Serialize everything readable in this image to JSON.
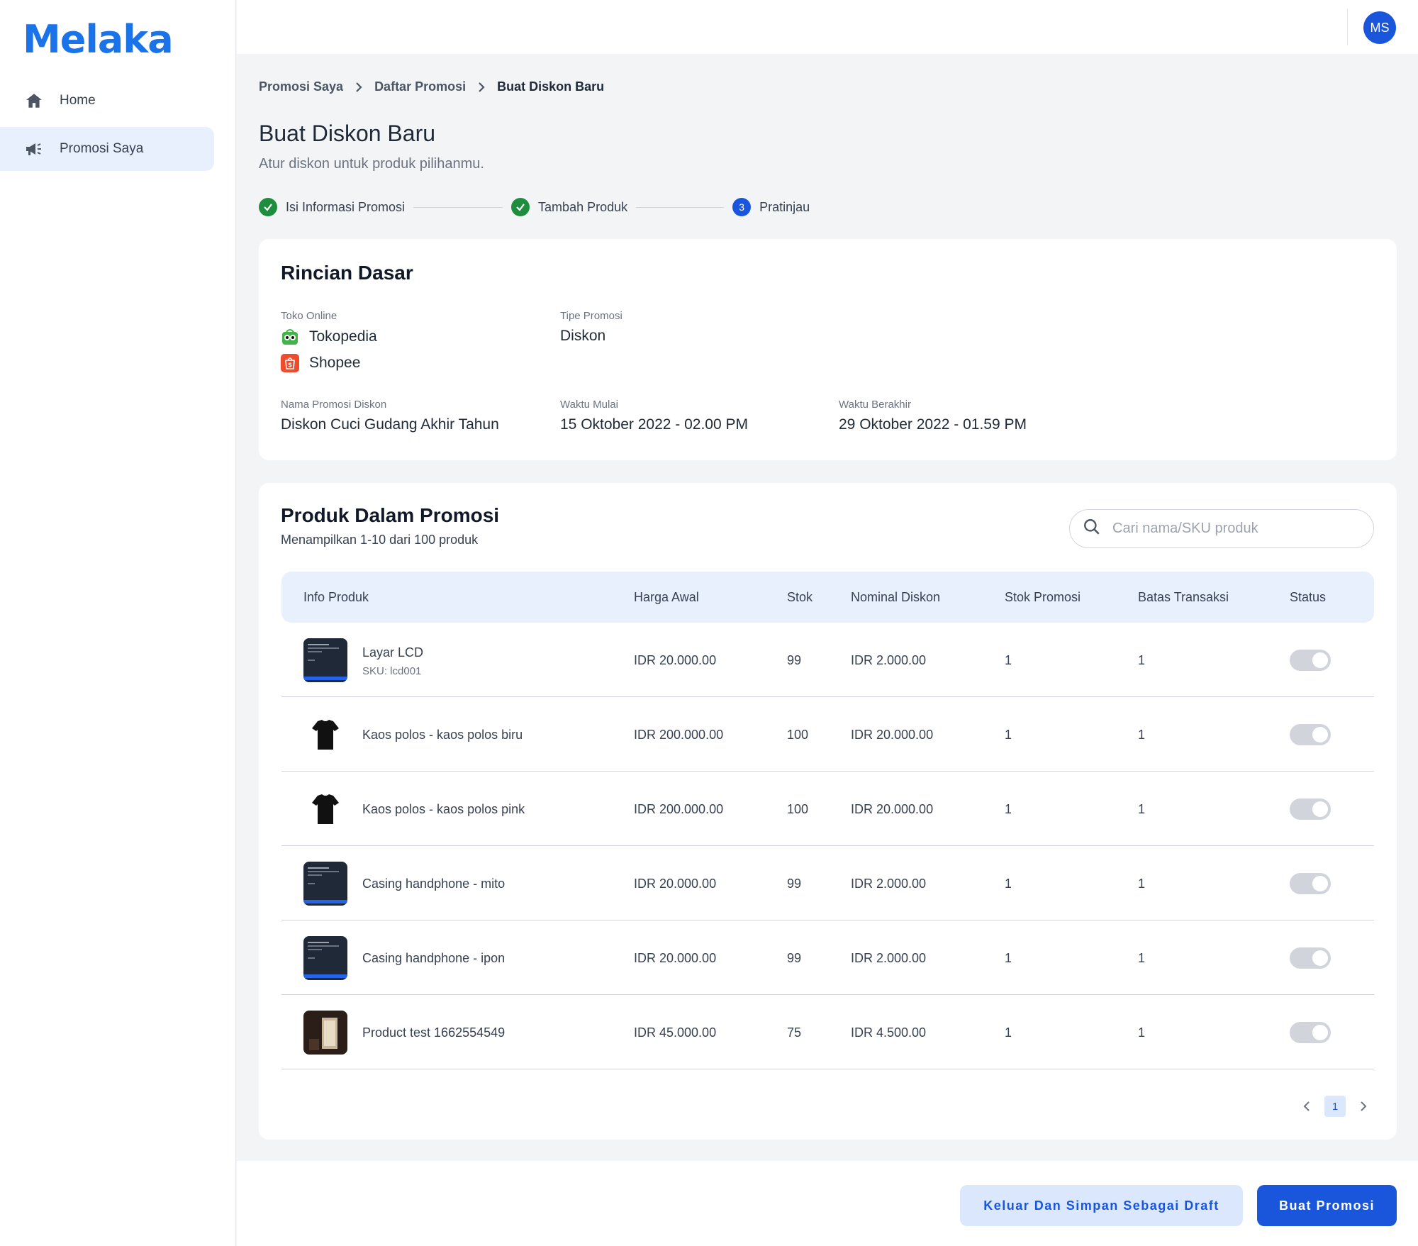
{
  "brand": {
    "name": "Melak",
    "tail": "a"
  },
  "sidebar": {
    "items": [
      {
        "label": "Home",
        "icon": "home-icon"
      },
      {
        "label": "Promosi Saya",
        "icon": "megaphone-icon",
        "active": true
      }
    ]
  },
  "header": {
    "avatar_initials": "MS"
  },
  "breadcrumb": [
    "Promosi Saya",
    "Daftar Promosi",
    "Buat Diskon Baru"
  ],
  "page": {
    "title": "Buat Diskon Baru",
    "subtitle": "Atur diskon untuk produk pilihanmu."
  },
  "stepper": [
    {
      "label": "Isi Informasi Promosi",
      "state": "done"
    },
    {
      "label": "Tambah Produk",
      "state": "done"
    },
    {
      "label": "Pratinjau",
      "state": "current",
      "number": "3"
    }
  ],
  "basic": {
    "title": "Rincian Dasar",
    "store_label": "Toko Online",
    "stores": [
      "Tokopedia",
      "Shopee"
    ],
    "type_label": "Tipe Promosi",
    "type_value": "Diskon",
    "name_label": "Nama Promosi Diskon",
    "name_value": "Diskon Cuci Gudang Akhir Tahun",
    "start_label": "Waktu Mulai",
    "start_value": "15 Oktober 2022 - 02.00 PM",
    "end_label": "Waktu Berakhir",
    "end_value": "29 Oktober 2022 - 01.59 PM"
  },
  "products": {
    "title": "Produk Dalam Promosi",
    "subtitle": "Menampilkan 1-10 dari 100 produk",
    "search_placeholder": "Cari nama/SKU produk",
    "columns": [
      "Info Produk",
      "Harga Awal",
      "Stok",
      "Nominal Diskon",
      "Stok Promosi",
      "Batas Transaksi",
      "Status"
    ],
    "rows": [
      {
        "name": "Layar LCD",
        "sku": "SKU: lcd001",
        "price": "IDR 20.000.00",
        "stock": "99",
        "discount": "IDR 2.000.00",
        "promo_stock": "1",
        "limit": "1",
        "thumb": "screen"
      },
      {
        "name": "Kaos polos - kaos polos biru",
        "sku": "",
        "price": "IDR 200.000.00",
        "stock": "100",
        "discount": "IDR 20.000.00",
        "promo_stock": "1",
        "limit": "1",
        "thumb": "tshirt"
      },
      {
        "name": "Kaos polos - kaos polos pink",
        "sku": "",
        "price": "IDR 200.000.00",
        "stock": "100",
        "discount": "IDR 20.000.00",
        "promo_stock": "1",
        "limit": "1",
        "thumb": "tshirt"
      },
      {
        "name": "Casing handphone - mito",
        "sku": "",
        "price": "IDR 20.000.00",
        "stock": "99",
        "discount": "IDR 2.000.00",
        "promo_stock": "1",
        "limit": "1",
        "thumb": "screen"
      },
      {
        "name": "Casing handphone - ipon",
        "sku": "",
        "price": "IDR 20.000.00",
        "stock": "99",
        "discount": "IDR 2.000.00",
        "promo_stock": "1",
        "limit": "1",
        "thumb": "screen"
      },
      {
        "name": "Product test 1662554549",
        "sku": "",
        "price": "IDR 45.000.00",
        "stock": "75",
        "discount": "IDR 4.500.00",
        "promo_stock": "1",
        "limit": "1",
        "thumb": "photo"
      }
    ],
    "current_page": "1"
  },
  "footer": {
    "draft_label": "Keluar Dan Simpan Sebagai Draft",
    "create_label": "Buat Promosi"
  },
  "colors": {
    "primary": "#1a56db",
    "brand": "#1a73e8",
    "success": "#1e8e3e"
  }
}
